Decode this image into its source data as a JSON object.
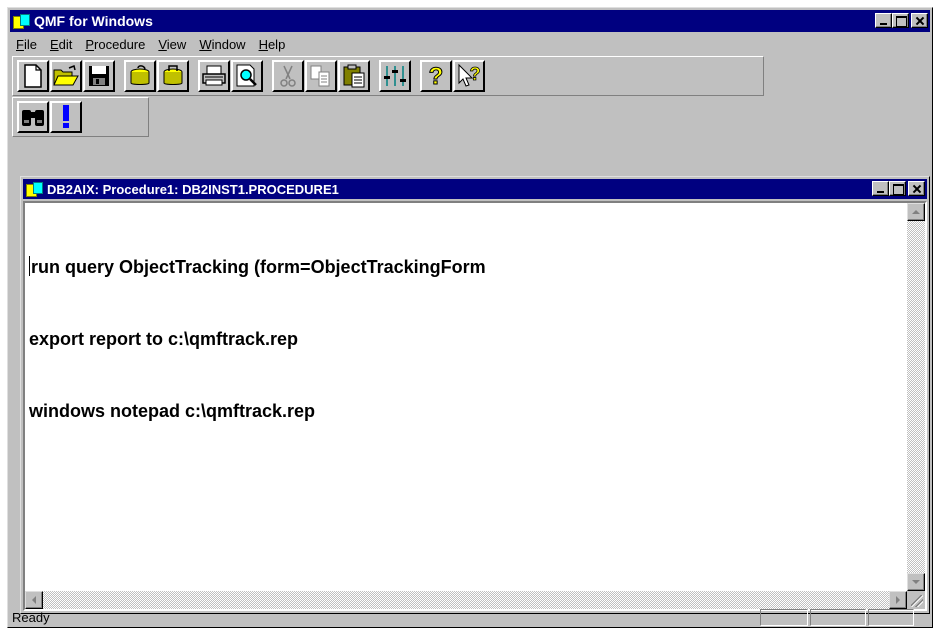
{
  "app": {
    "title": "QMF for Windows"
  },
  "menu": [
    {
      "label": "File",
      "key": "F",
      "rest": "ile"
    },
    {
      "label": "Edit",
      "key": "E",
      "rest": "dit"
    },
    {
      "label": "Procedure",
      "key": "P",
      "rest": "rocedure"
    },
    {
      "label": "View",
      "key": "V",
      "rest": "iew"
    },
    {
      "label": "Window",
      "key": "W",
      "rest": "indow"
    },
    {
      "label": "Help",
      "key": "H",
      "rest": "elp"
    }
  ],
  "toolbar": {
    "buttons": [
      {
        "name": "new",
        "icon": "new-document-icon"
      },
      {
        "name": "open",
        "icon": "open-folder-icon"
      },
      {
        "name": "save",
        "icon": "save-disk-icon"
      },
      {
        "name": "retrieve-from-database",
        "icon": "database-get-icon"
      },
      {
        "name": "save-to-database",
        "icon": "database-save-icon"
      },
      {
        "name": "print",
        "icon": "printer-icon"
      },
      {
        "name": "print-preview",
        "icon": "print-preview-icon"
      },
      {
        "name": "cut",
        "icon": "scissors-icon",
        "disabled": true
      },
      {
        "name": "copy",
        "icon": "copy-icon",
        "disabled": true
      },
      {
        "name": "paste",
        "icon": "paste-icon"
      },
      {
        "name": "options",
        "icon": "sliders-icon"
      },
      {
        "name": "help",
        "icon": "question-mark-icon"
      },
      {
        "name": "context-help",
        "icon": "pointer-question-icon"
      }
    ],
    "secondary": [
      {
        "name": "find",
        "icon": "binoculars-icon"
      },
      {
        "name": "run",
        "icon": "exclamation-icon"
      }
    ]
  },
  "document": {
    "title": "DB2AIX: Procedure1: DB2INST1.PROCEDURE1",
    "lines": [
      "run query ObjectTracking (form=ObjectTrackingForm",
      "export report to c:\\qmftrack.rep",
      "windows notepad c:\\qmftrack.rep"
    ]
  },
  "status": {
    "text": "Ready"
  }
}
